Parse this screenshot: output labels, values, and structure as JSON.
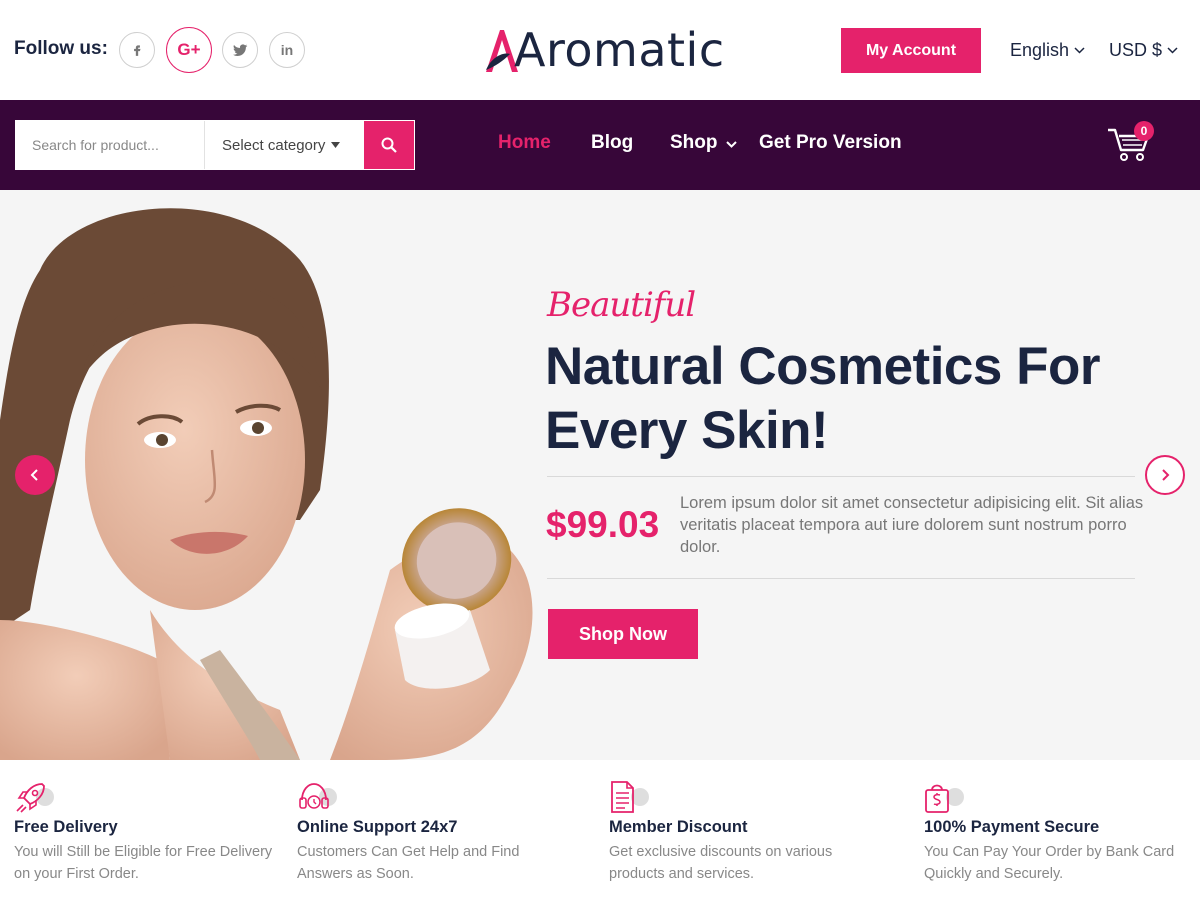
{
  "header": {
    "follow_label": "Follow us:",
    "social": [
      {
        "icon": "facebook-icon",
        "glyph": "f"
      },
      {
        "icon": "google-plus-icon",
        "glyph": "G+"
      },
      {
        "icon": "twitter-icon",
        "glyph": "t"
      },
      {
        "icon": "linkedin-icon",
        "glyph": "in"
      }
    ],
    "logo_text": "Aromatic",
    "my_account": "My Account",
    "language": "English",
    "currency": "USD $"
  },
  "nav": {
    "search_placeholder": "Search for product...",
    "category": "Select category",
    "items": [
      "Home",
      "Blog",
      "Shop",
      "Get Pro Version"
    ],
    "active": "Home",
    "cart_count": "0"
  },
  "hero": {
    "eyebrow": "Beautiful",
    "headline_line1": "Natural Cosmetics For",
    "headline_line2": "Every Skin!",
    "price": "$99.03",
    "description": "Lorem ipsum dolor sit amet consectetur adipisicing elit. Sit alias veritatis placeat tempora aut iure dolorem sunt nostrum porro dolor.",
    "cta": "Shop Now"
  },
  "features": [
    {
      "icon": "rocket-icon",
      "title": "Free Delivery",
      "desc": "You will Still be Eligible for Free Delivery on your First Order."
    },
    {
      "icon": "headset-icon",
      "title": "Online Support 24x7",
      "desc": "Customers Can Get Help and Find Answers as Soon."
    },
    {
      "icon": "document-icon",
      "title": "Member Discount",
      "desc": "Get exclusive discounts on various products and services."
    },
    {
      "icon": "secure-bag-icon",
      "title": "100% Payment Secure",
      "desc": "You Can Pay Your Order by Bank Card Quickly and Securely."
    }
  ],
  "colors": {
    "accent": "#e5226b",
    "nav_bg": "#370639",
    "heading": "#1b2540",
    "hero_bg": "#f5f5f5"
  }
}
